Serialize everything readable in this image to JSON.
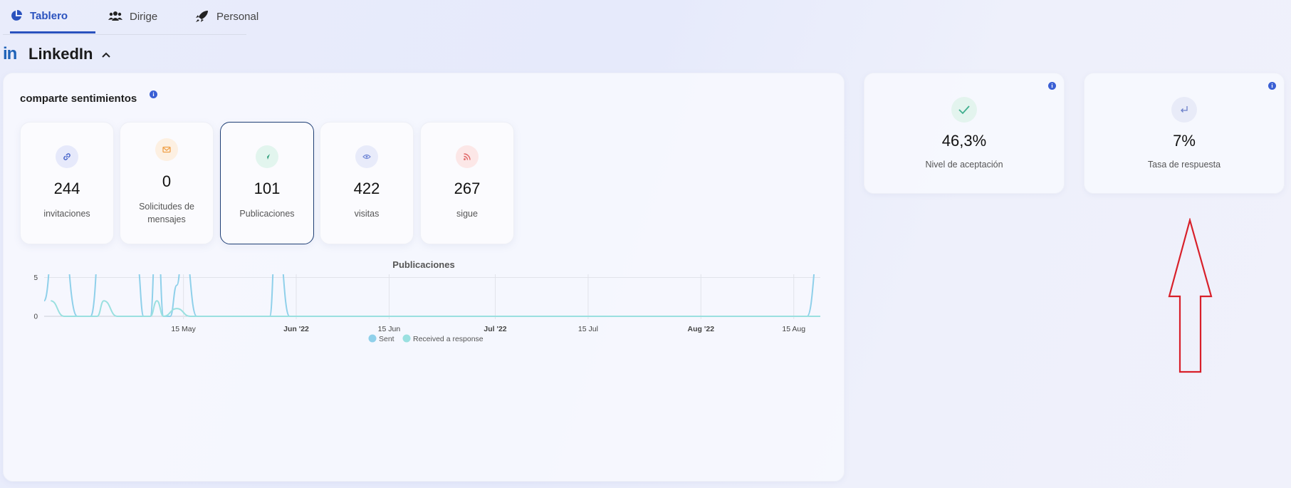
{
  "tabs": [
    {
      "label": "Tablero",
      "icon": "pie-chart-icon",
      "active": true
    },
    {
      "label": "Dirige",
      "icon": "users-icon",
      "active": false
    },
    {
      "label": "Personal",
      "icon": "rocket-icon",
      "active": false
    }
  ],
  "section": {
    "logo": "in",
    "title": "LinkedIn"
  },
  "main_card": {
    "title": "comparte sentimientos"
  },
  "metrics": [
    {
      "value": "244",
      "label": "invitaciones",
      "icon": "link-icon",
      "color": "#4663c9",
      "bg": "#e6e9fb"
    },
    {
      "value": "0",
      "label": "Solicitudes de mensajes",
      "icon": "envelope-icon",
      "color": "#f0a14a",
      "bg": "#fdf0e2"
    },
    {
      "value": "101",
      "label": "Publicaciones",
      "icon": "send-icon",
      "color": "#2f9e7a",
      "bg": "#e2f5ee"
    },
    {
      "value": "422",
      "label": "visitas",
      "icon": "eye-icon",
      "color": "#6f86d6",
      "bg": "#e8ebfa"
    },
    {
      "value": "267",
      "label": "sigue",
      "icon": "rss-icon",
      "color": "#e06565",
      "bg": "#fce7e7"
    }
  ],
  "side_cards": [
    {
      "value": "46,3%",
      "label": "Nivel de aceptación",
      "icon": "check-icon",
      "color": "#3fae8e",
      "bg": "#e3f4ee"
    },
    {
      "value": "7%",
      "label": "Tasa de respuesta",
      "icon": "reply-arrow-icon",
      "color": "#6b7fc9",
      "bg": "#e8ebf8"
    }
  ],
  "chart_data": {
    "type": "line",
    "title": "Publicaciones",
    "ylim": [
      0,
      20
    ],
    "yticks": [
      0,
      5,
      10,
      15,
      20
    ],
    "xlim": [
      "2022-04-24",
      "2022-08-19"
    ],
    "xticks": [
      {
        "date": "2022-05-15",
        "label": "15 May",
        "bold": false
      },
      {
        "date": "2022-06-01",
        "label": "Jun '22",
        "bold": true
      },
      {
        "date": "2022-06-15",
        "label": "15 Jun",
        "bold": false
      },
      {
        "date": "2022-07-01",
        "label": "Jul '22",
        "bold": true
      },
      {
        "date": "2022-07-15",
        "label": "15 Jul",
        "bold": false
      },
      {
        "date": "2022-08-01",
        "label": "Aug '22",
        "bold": true
      },
      {
        "date": "2022-08-15",
        "label": "15 Aug",
        "bold": false
      }
    ],
    "grid": true,
    "legend_position": "bottom",
    "series": [
      {
        "name": "Sent",
        "color": "#8fd0ea",
        "points": [
          [
            "2022-04-24",
            2
          ],
          [
            "2022-04-26",
            18
          ],
          [
            "2022-04-29",
            0
          ],
          [
            "2022-05-01",
            0
          ],
          [
            "2022-05-03",
            17
          ],
          [
            "2022-05-05",
            7
          ],
          [
            "2022-05-08",
            7
          ],
          [
            "2022-05-09",
            0
          ],
          [
            "2022-05-10",
            0
          ],
          [
            "2022-05-11",
            14
          ],
          [
            "2022-05-12",
            0
          ],
          [
            "2022-05-13",
            0
          ],
          [
            "2022-05-14",
            4
          ],
          [
            "2022-05-15",
            10
          ],
          [
            "2022-05-17",
            0
          ],
          [
            "2022-05-28",
            0
          ],
          [
            "2022-05-29",
            12
          ],
          [
            "2022-05-31",
            0
          ],
          [
            "2022-08-17",
            0
          ],
          [
            "2022-08-19",
            10
          ]
        ]
      },
      {
        "name": "Received a response",
        "color": "#9ae0e0",
        "points": [
          [
            "2022-04-25",
            2
          ],
          [
            "2022-04-27",
            0
          ],
          [
            "2022-05-02",
            0
          ],
          [
            "2022-05-03",
            2
          ],
          [
            "2022-05-05",
            0
          ],
          [
            "2022-05-10",
            0
          ],
          [
            "2022-05-11",
            2
          ],
          [
            "2022-05-12",
            0
          ],
          [
            "2022-05-14",
            1
          ],
          [
            "2022-05-16",
            0
          ],
          [
            "2022-08-19",
            0
          ]
        ]
      }
    ]
  }
}
